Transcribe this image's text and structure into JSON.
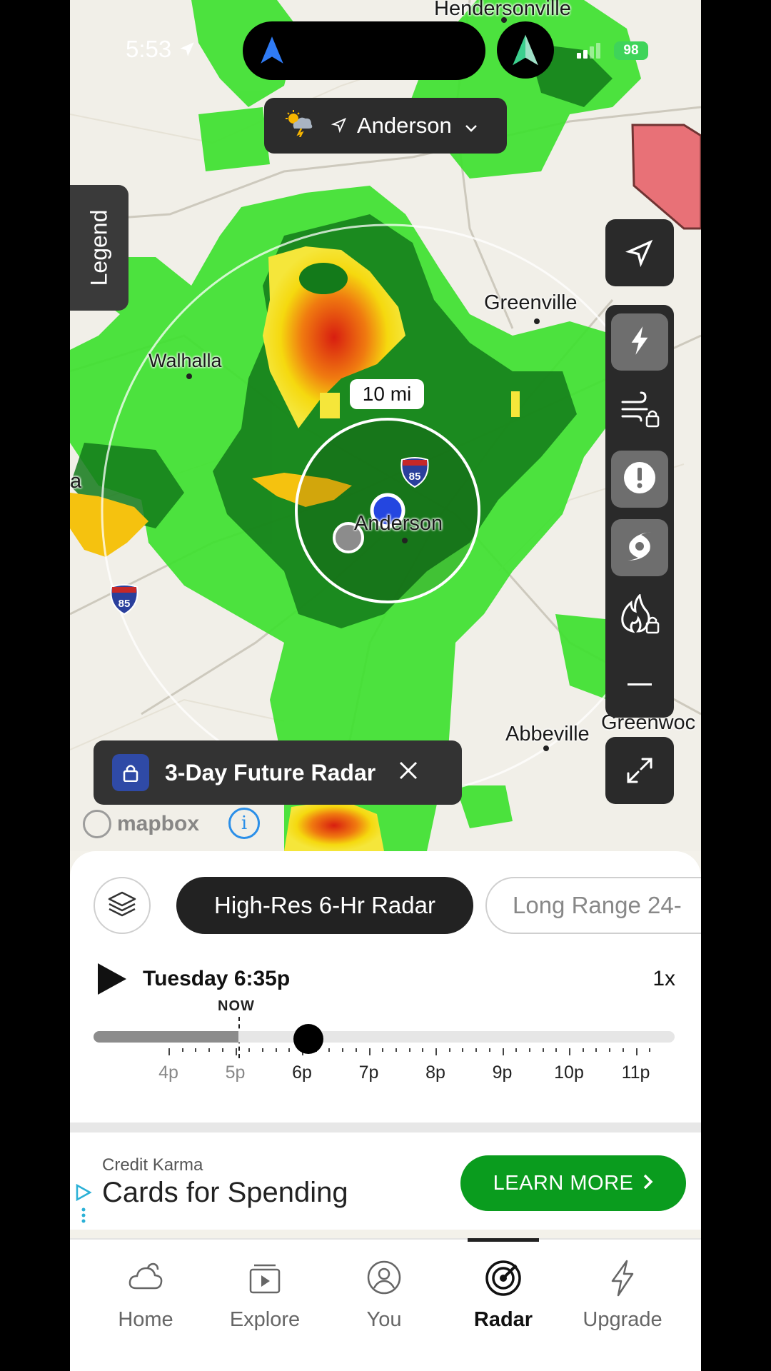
{
  "status_bar": {
    "time": "5:53",
    "battery": "98"
  },
  "location": {
    "name": "Anderson"
  },
  "legend_label": "Legend",
  "map_labels": {
    "hendersonville": "Hendersonville",
    "greenville": "Greenville",
    "walhalla": "Walhalla",
    "anderson": "Anderson",
    "abbeville": "Abbeville",
    "greenwood": "Greenwoc",
    "edge_a": "a",
    "interstate": "85",
    "radius": "10 mi",
    "attribution": "mapbox"
  },
  "future_radar": {
    "label": "3-Day Future Radar"
  },
  "radar_tabs": {
    "active": "High-Res 6-Hr Radar",
    "inactive": "Long Range 24-"
  },
  "player": {
    "day_time": "Tuesday 6:35p",
    "speed": "1x",
    "now_label": "NOW",
    "progress": 0.37,
    "ticks": [
      {
        "label": "4p",
        "past": true
      },
      {
        "label": "5p",
        "past": true
      },
      {
        "label": "6p",
        "past": false
      },
      {
        "label": "7p",
        "past": false
      },
      {
        "label": "8p",
        "past": false
      },
      {
        "label": "9p",
        "past": false
      },
      {
        "label": "10p",
        "past": false
      },
      {
        "label": "11p",
        "past": false
      }
    ]
  },
  "ad": {
    "sponsor": "Credit Karma",
    "title": "Cards for Spending",
    "cta": "LEARN MORE"
  },
  "tabs": [
    {
      "label": "Home",
      "icon": "cloud-icon"
    },
    {
      "label": "Explore",
      "icon": "video-icon"
    },
    {
      "label": "You",
      "icon": "user-icon"
    },
    {
      "label": "Radar",
      "icon": "radar-icon"
    },
    {
      "label": "Upgrade",
      "icon": "bolt-icon"
    }
  ],
  "colors": {
    "accent_green": "#0a9c1e",
    "radar_green": "#3ee12f",
    "location_blue": "#2446e0"
  }
}
